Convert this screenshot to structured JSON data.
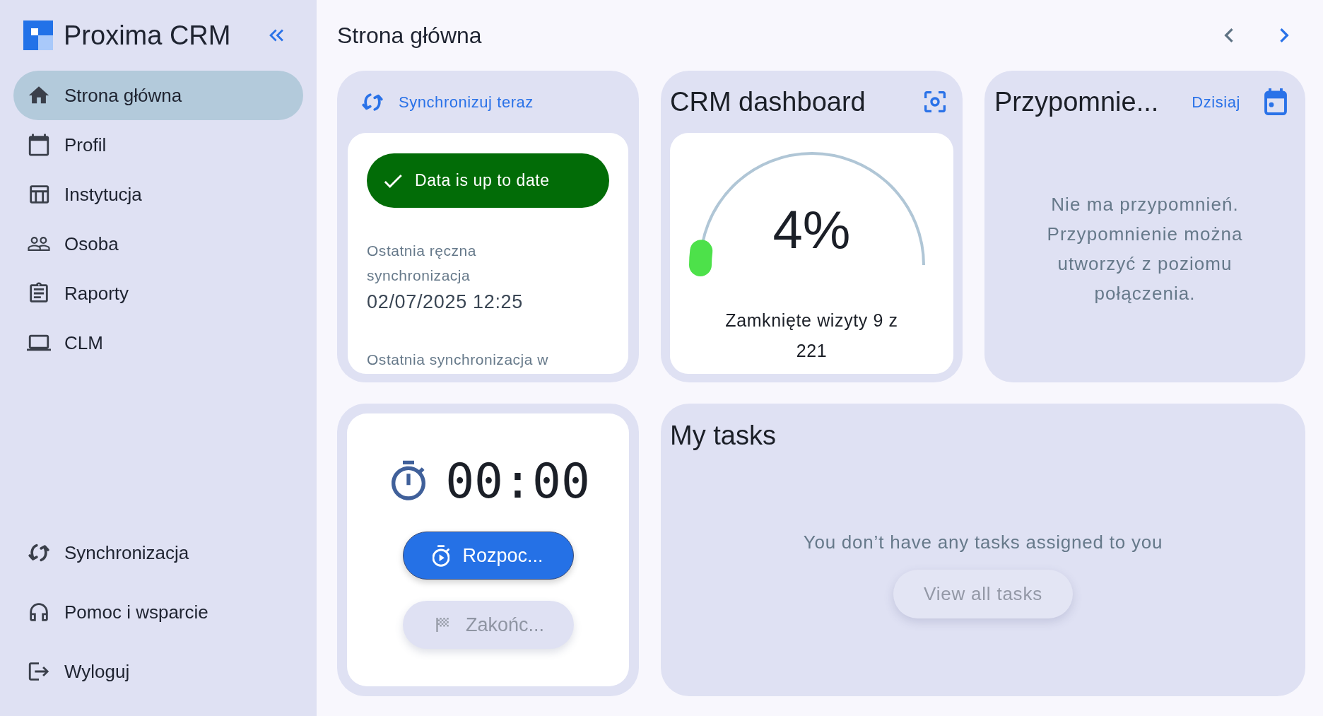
{
  "sidebar": {
    "brand": "Proxima CRM",
    "nav_items": [
      {
        "label": "Strona główna",
        "selected": true
      },
      {
        "label": "Profil",
        "selected": false
      },
      {
        "label": "Instytucja",
        "selected": false
      },
      {
        "label": "Osoba",
        "selected": false
      },
      {
        "label": "Raporty",
        "selected": false
      },
      {
        "label": "CLM",
        "selected": false
      }
    ],
    "bottom_items": [
      {
        "label": "Synchronizacja"
      },
      {
        "label": "Pomoc i wsparcie"
      },
      {
        "label": "Wyloguj"
      }
    ]
  },
  "header": {
    "title": "Strona główna",
    "pager": {
      "prev": {
        "disabled": true
      },
      "next": {
        "disabled": false
      }
    }
  },
  "sync_card": {
    "action": "Synchronizuj teraz",
    "status": "Data is up to date",
    "last_manual_label": "Ostatnia ręczna synchronizacja",
    "last_manual_value": "02/07/2025 12:25",
    "last_sync_label": "Ostatnia synchronizacja w"
  },
  "dashboard_card": {
    "title": "CRM dashboard",
    "gauge": {
      "reading": "4%",
      "level": 0.04,
      "caption": "Zamknięte wizyty 9 z 221"
    }
  },
  "reminders_card": {
    "title": "Przypomnie...",
    "today_link": "Dzisiaj",
    "empty_message": "Nie ma przypomnień. Przypomnienie można utworzyć z poziomu połączenia."
  },
  "timer_card": {
    "time": "00:00",
    "buttons": [
      {
        "label": "Rozpoc...",
        "kind": "start",
        "disabled": false
      },
      {
        "label": "Zakońc...",
        "kind": "finish",
        "disabled": true
      }
    ]
  },
  "tasks_card": {
    "title": "My tasks",
    "empty_message": "You don’t have any tasks assigned to you",
    "button": {
      "label": "View all tasks",
      "disabled": true
    }
  }
}
